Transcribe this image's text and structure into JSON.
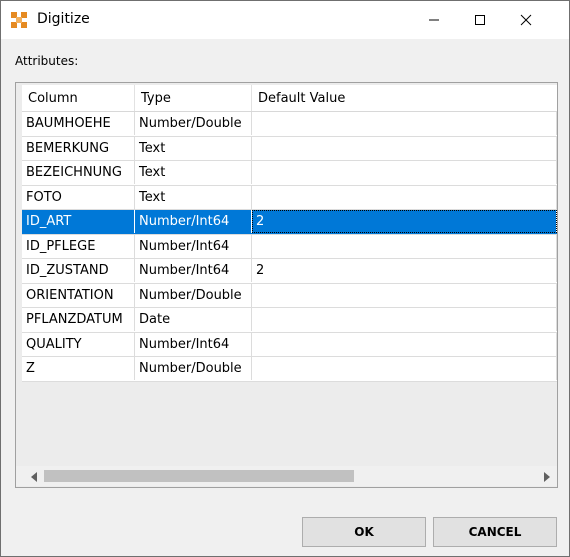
{
  "window": {
    "title": "Digitize"
  },
  "attributes_label": "Attributes:",
  "table": {
    "headers": [
      "Column",
      "Type",
      "Default Value"
    ],
    "rows": [
      {
        "column": "BAUMHOEHE",
        "type": "Number/Double",
        "default": ""
      },
      {
        "column": "BEMERKUNG",
        "type": "Text",
        "default": ""
      },
      {
        "column": "BEZEICHNUNG",
        "type": "Text",
        "default": ""
      },
      {
        "column": "FOTO",
        "type": "Text",
        "default": ""
      },
      {
        "column": "ID_ART",
        "type": "Number/Int64",
        "default": "2",
        "selected": true
      },
      {
        "column": "ID_PFLEGE",
        "type": "Number/Int64",
        "default": ""
      },
      {
        "column": "ID_ZUSTAND",
        "type": "Number/Int64",
        "default": "2"
      },
      {
        "column": "ORIENTATION",
        "type": "Number/Double",
        "default": ""
      },
      {
        "column": "PFLANZDATUM",
        "type": "Date",
        "default": ""
      },
      {
        "column": "QUALITY",
        "type": "Number/Int64",
        "default": ""
      },
      {
        "column": "Z",
        "type": "Number/Double",
        "default": ""
      }
    ]
  },
  "buttons": {
    "ok": "OK",
    "cancel": "CANCEL"
  },
  "colors": {
    "selection": "#0078d7",
    "app_icon": "#e58a22"
  },
  "icons": [
    "app-icon",
    "minimize-icon",
    "maximize-icon",
    "close-icon",
    "scroll-left-icon",
    "scroll-right-icon"
  ]
}
